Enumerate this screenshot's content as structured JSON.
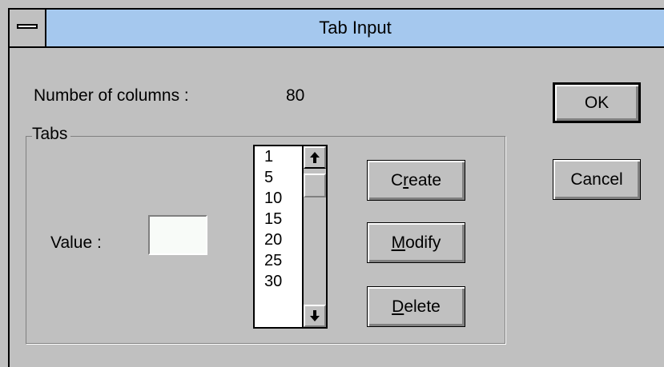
{
  "window": {
    "title": "Tab Input"
  },
  "columns": {
    "label": "Number of columns :",
    "value": "80"
  },
  "tabs_group": {
    "title": "Tabs",
    "value_label": "Value :",
    "value_input": "",
    "list_items": [
      "1",
      "5",
      "10",
      "15",
      "20",
      "25",
      "30"
    ],
    "scroll_up_glyph": "🠕",
    "scroll_down_glyph": "🠗"
  },
  "buttons": {
    "create": {
      "pre": "C",
      "accel": "r",
      "post": "eate"
    },
    "modify": {
      "pre": "",
      "accel": "M",
      "post": "odify"
    },
    "delete": {
      "pre": "",
      "accel": "D",
      "post": "elete"
    },
    "ok": "OK",
    "cancel": "Cancel"
  }
}
